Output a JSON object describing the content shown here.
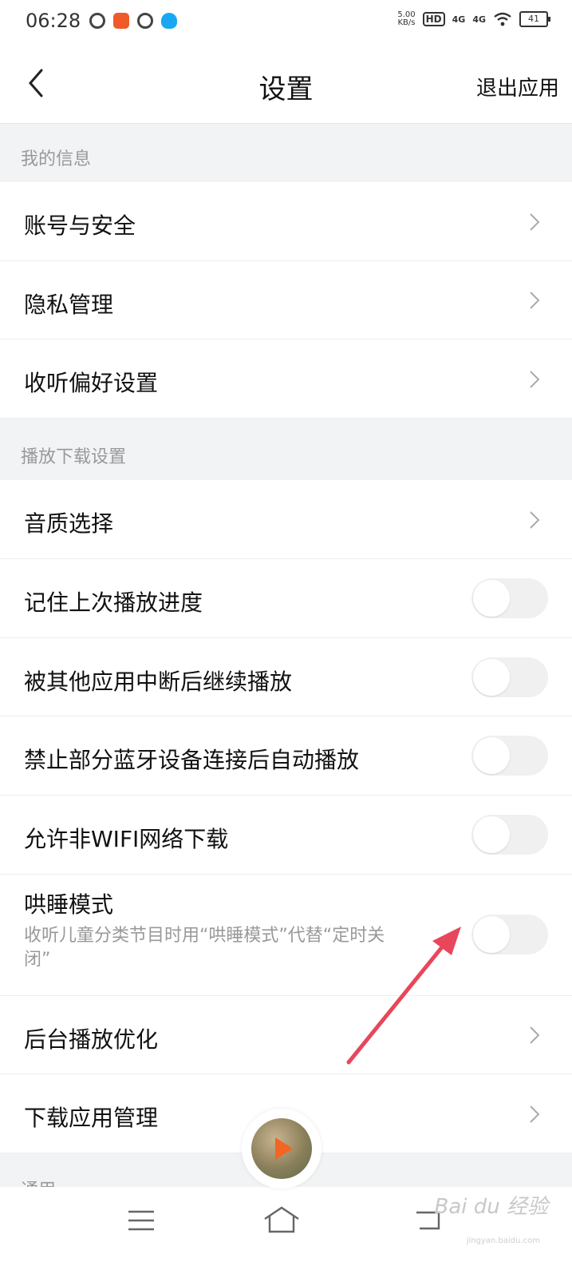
{
  "status_bar": {
    "time": "06:28",
    "net_speed_value": "5.00",
    "net_speed_unit": "KB/s",
    "hd_badge": "HD",
    "sim1": "4G",
    "sim2": "4G",
    "battery": "41"
  },
  "header": {
    "title": "设置",
    "exit_label": "退出应用"
  },
  "sections": {
    "my_info": "我的信息",
    "playback": "播放下载设置",
    "general": "通用"
  },
  "rows": {
    "account": "账号与安全",
    "privacy": "隐私管理",
    "listen_pref": "收听偏好设置",
    "audio_quality": "音质选择",
    "remember_progress": "记住上次播放进度",
    "resume_after_interrupt": "被其他应用中断后继续播放",
    "block_bluetooth_autoplay": "禁止部分蓝牙设备连接后自动播放",
    "allow_non_wifi": "允许非WIFI网络下载",
    "sleep_mode": "哄睡模式",
    "sleep_mode_desc": "收听儿童分类节目时用“哄睡模式”代替“定时关闭”",
    "background_opt": "后台播放优化",
    "download_app": "下载应用管理"
  },
  "toggles": {
    "remember_progress": false,
    "resume_after_interrupt": false,
    "block_bluetooth_autoplay": false,
    "allow_non_wifi": false,
    "sleep_mode": false
  },
  "watermark": {
    "brand": "Bai du 经验",
    "url": "jingyan.baidu.com"
  },
  "colors": {
    "annotation_arrow": "#e8475b",
    "accent_orange": "#f08a24"
  }
}
